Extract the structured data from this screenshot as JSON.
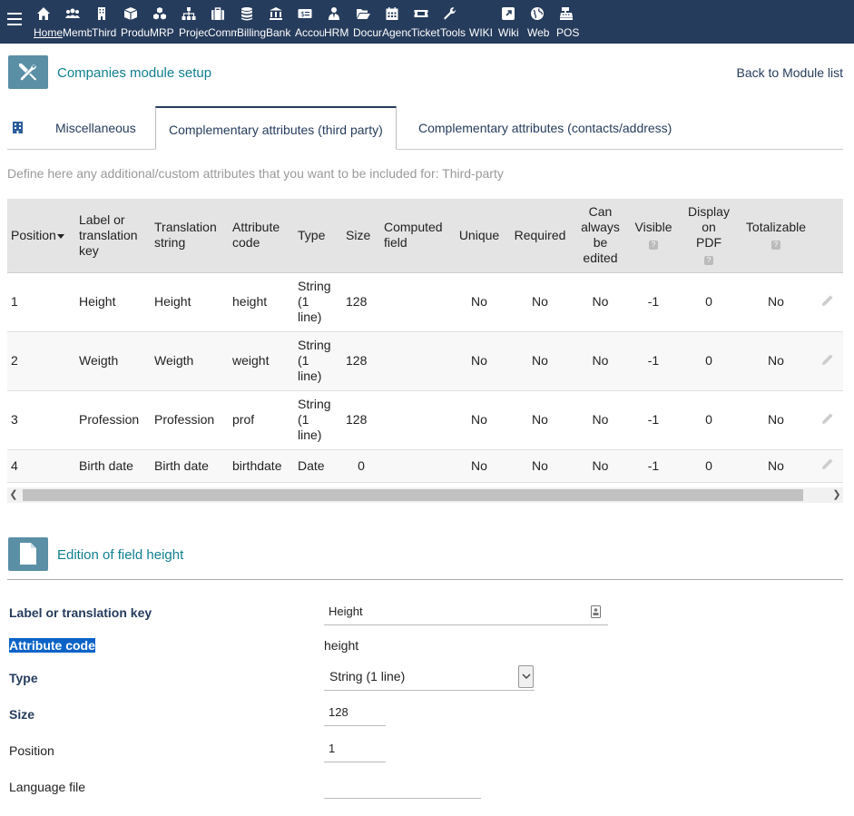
{
  "topbar": {
    "menu": [
      {
        "label": "Home",
        "icon": "home-icon"
      },
      {
        "label": "Members",
        "icon": "members-icon"
      },
      {
        "label": "Third",
        "icon": "building-icon"
      },
      {
        "label": "Products",
        "icon": "cube-icon"
      },
      {
        "label": "MRP",
        "icon": "cubes-icon"
      },
      {
        "label": "Projects",
        "icon": "sitemap-icon"
      },
      {
        "label": "Commerce",
        "icon": "suitcase-icon"
      },
      {
        "label": "Billing",
        "icon": "coins-icon"
      },
      {
        "label": "Bank",
        "icon": "bank-icon"
      },
      {
        "label": "Accounting",
        "icon": "money-check-icon"
      },
      {
        "label": "HRM",
        "icon": "user-tie-icon"
      },
      {
        "label": "Documents",
        "icon": "folder-open-icon"
      },
      {
        "label": "Agenda",
        "icon": "calendar-icon"
      },
      {
        "label": "Tickets",
        "icon": "ticket-icon"
      },
      {
        "label": "Tools",
        "icon": "wrench-icon"
      },
      {
        "label": "WIKI",
        "icon": ""
      },
      {
        "label": "Wiki",
        "icon": "external-link-icon"
      },
      {
        "label": "Web",
        "icon": "globe-icon"
      },
      {
        "label": "POS",
        "icon": "cash-register-icon"
      }
    ]
  },
  "header": {
    "title": "Companies module setup",
    "back_link": "Back to Module list"
  },
  "tabs": [
    {
      "label": "Miscellaneous"
    },
    {
      "label": "Complementary attributes (third party)"
    },
    {
      "label": "Complementary attributes (contacts/address)"
    }
  ],
  "intro": "Define here any additional/custom attributes that you want to be included for: Third-party",
  "table": {
    "headers": {
      "position": "Position",
      "label_1": "Label or",
      "label_2": "translation",
      "label_3": "key",
      "translation_1": "Translation",
      "translation_2": "string",
      "attrcode_1": "Attribute",
      "attrcode_2": "code",
      "type": "Type",
      "size": "Size",
      "computed_1": "Computed",
      "computed_2": "field",
      "unique": "Unique",
      "required": "Required",
      "always_1": "Can",
      "always_2": "always",
      "always_3": "be",
      "always_4": "edited",
      "visible": "Visible",
      "pdf_1": "Display",
      "pdf_2": "on",
      "pdf_3": "PDF",
      "totalizable": "Totalizable",
      "help": "?"
    },
    "rows": [
      {
        "position": "1",
        "label": "Height",
        "translation": "Height",
        "code": "height",
        "type_1": "String",
        "type_2": "(1",
        "type_3": "line)",
        "size": "128",
        "computed": "",
        "unique": "No",
        "required": "No",
        "always_editable": "No",
        "visible": "-1",
        "pdf": "0",
        "totalizable": "No"
      },
      {
        "position": "2",
        "label": "Weigth",
        "translation": "Weigth",
        "code": "weight",
        "type_1": "String",
        "type_2": "(1",
        "type_3": "line)",
        "size": "128",
        "computed": "",
        "unique": "No",
        "required": "No",
        "always_editable": "No",
        "visible": "-1",
        "pdf": "0",
        "totalizable": "No"
      },
      {
        "position": "3",
        "label": "Profession",
        "translation": "Profession",
        "code": "prof",
        "type_1": "String",
        "type_2": "(1",
        "type_3": "line)",
        "size": "128",
        "computed": "",
        "unique": "No",
        "required": "No",
        "always_editable": "No",
        "visible": "-1",
        "pdf": "0",
        "totalizable": "No"
      },
      {
        "position": "4",
        "label": "Birth date",
        "translation": "Birth date",
        "code": "birthdate",
        "type_1": "Date",
        "size": "0",
        "computed": "",
        "unique": "No",
        "required": "No",
        "always_editable": "No",
        "visible": "-1",
        "pdf": "0",
        "totalizable": "No"
      }
    ]
  },
  "edit": {
    "title": "Edition of field height",
    "label_key": "Label or translation key",
    "label_key_value": "Height",
    "attr_code": "Attribute code",
    "attr_code_value": "height",
    "type": "Type",
    "type_value": "String (1 line)",
    "size": "Size",
    "size_value": "128",
    "position": "Position",
    "position_value": "1",
    "language_file": "Language file",
    "language_file_value": ""
  },
  "colors": {
    "topbar": "#263c5c",
    "accent_title": "#0f7f8f",
    "icon_box": "#5a8fa6",
    "selection": "#0b63c8"
  }
}
